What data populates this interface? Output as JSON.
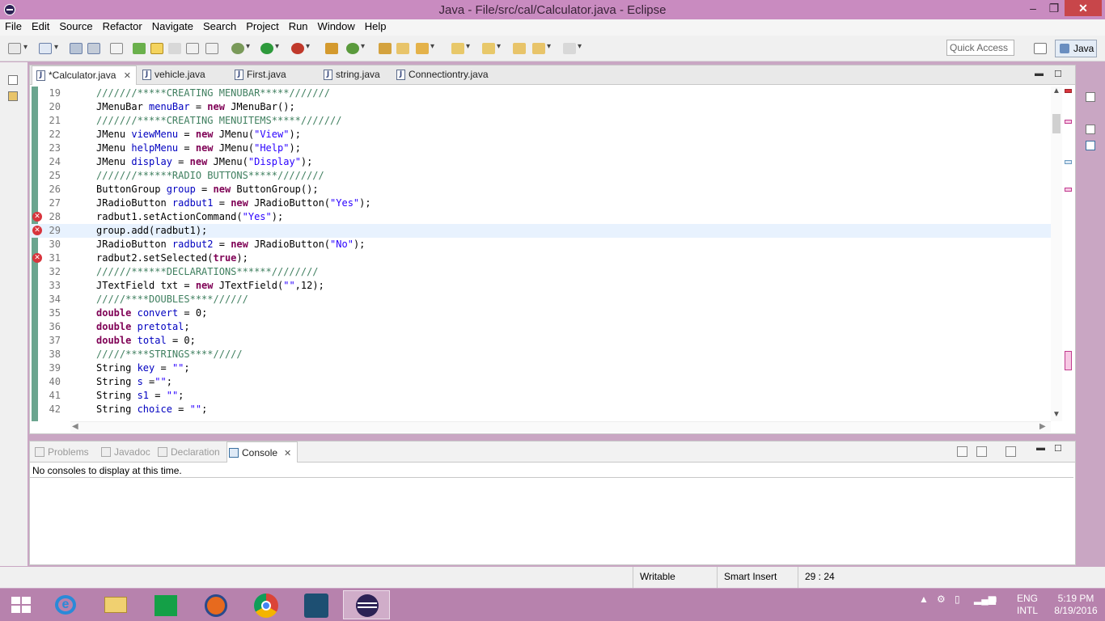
{
  "window": {
    "title": "Java - File/src/cal/Calculator.java - Eclipse",
    "min": "‒",
    "max": "❐",
    "close": "✕"
  },
  "menu": [
    "File",
    "Edit",
    "Source",
    "Refactor",
    "Navigate",
    "Search",
    "Project",
    "Run",
    "Window",
    "Help"
  ],
  "toolbar": {
    "quick_access_placeholder": "Quick Access",
    "perspective": "Java"
  },
  "editor": {
    "tabs": [
      {
        "label": "*Calculator.java",
        "active": true,
        "close": "✕"
      },
      {
        "label": "vehicle.java"
      },
      {
        "label": "First.java"
      },
      {
        "label": "string.java"
      },
      {
        "label": "Connectiontry.java"
      }
    ],
    "current_line": 29,
    "lines": [
      {
        "n": "19",
        "text": "///////*****CREATING MENUBAR*****///////"
      },
      {
        "n": "20",
        "text": "JMenuBar menuBar = new JMenuBar();"
      },
      {
        "n": "21",
        "text": "///////*****CREATING MENUITEMS*****///////"
      },
      {
        "n": "22",
        "text": "JMenu viewMenu = new JMenu(\"View\");"
      },
      {
        "n": "23",
        "text": "JMenu helpMenu = new JMenu(\"Help\");"
      },
      {
        "n": "24",
        "text": "JMenu display = new JMenu(\"Display\");"
      },
      {
        "n": "25",
        "text": "///////******RADIO BUTTONS*****////////"
      },
      {
        "n": "26",
        "text": "ButtonGroup group = new ButtonGroup();"
      },
      {
        "n": "27",
        "text": "JRadioButton radbut1 = new JRadioButton(\"Yes\");"
      },
      {
        "n": "28",
        "text": "radbut1.setActionCommand(\"Yes\");",
        "error": true
      },
      {
        "n": "29",
        "text": "group.add(radbut1);",
        "error": true
      },
      {
        "n": "30",
        "text": "JRadioButton radbut2 = new JRadioButton(\"No\");"
      },
      {
        "n": "31",
        "text": "radbut2.setSelected(true);",
        "error": true
      },
      {
        "n": "32",
        "text": "//////******DECLARATIONS******////////"
      },
      {
        "n": "33",
        "text": "JTextField txt = new JTextField(\"\",12);"
      },
      {
        "n": "34",
        "text": "/////****DOUBLES****//////"
      },
      {
        "n": "35",
        "text": "double convert = 0;"
      },
      {
        "n": "36",
        "text": "double pretotal;"
      },
      {
        "n": "37",
        "text": "double total = 0;"
      },
      {
        "n": "38",
        "text": "/////****STRINGS****/////"
      },
      {
        "n": "39",
        "text": "String key = \"\";"
      },
      {
        "n": "40",
        "text": "String s =\"\";"
      },
      {
        "n": "41",
        "text": "String s1 = \"\";"
      },
      {
        "n": "42",
        "text": "String choice = \"\";"
      }
    ]
  },
  "console": {
    "tabs": [
      "Problems",
      "Javadoc",
      "Declaration",
      "Console"
    ],
    "active_tab": "Console",
    "close": "✕",
    "message": "No consoles to display at this time."
  },
  "status": {
    "mode": "Writable",
    "insert": "Smart Insert",
    "position": "29 : 24"
  },
  "taskbar": {
    "lang": "ENG",
    "layout": "INTL",
    "time": "5:19 PM",
    "date": "8/19/2016"
  },
  "colors": {
    "titlebar": "#c98bc0",
    "taskbar": "#b782ad",
    "error": "#d8343c",
    "keyword": "#7f0055",
    "comment": "#3f7f5f",
    "string": "#2a00ff",
    "field": "#0000c0"
  }
}
